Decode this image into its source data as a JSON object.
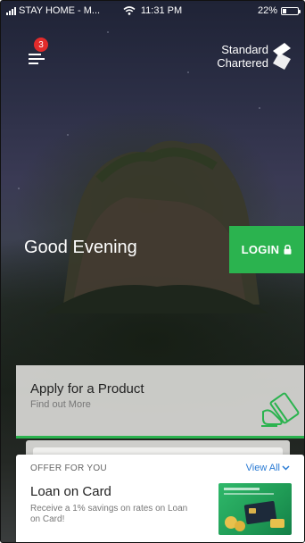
{
  "status_bar": {
    "carrier": "STAY HOME - M...",
    "time": "11:31 PM",
    "battery_percent": "22%",
    "battery_level": 0.22
  },
  "header": {
    "notification_count": "3",
    "brand_line1": "Standard",
    "brand_line2": "Chartered"
  },
  "greeting": "Good Evening",
  "login_label": "LOGIN",
  "product_card": {
    "title": "Apply for a Product",
    "subtitle": "Find out More"
  },
  "offer_card": {
    "label": "OFFER FOR YOU",
    "view_all": "View All",
    "title": "Loan on Card",
    "description": "Receive a 1% savings on rates on Loan on Card!"
  },
  "colors": {
    "accent_green": "#2bb34f",
    "badge_red": "#e22b2b",
    "link_blue": "#2a7bd4"
  },
  "icons": [
    "signal-icon",
    "wifi-icon",
    "battery-icon",
    "menu-icon",
    "standard-chartered-logo-icon",
    "lock-icon",
    "card-hand-icon",
    "chevron-down-icon"
  ]
}
